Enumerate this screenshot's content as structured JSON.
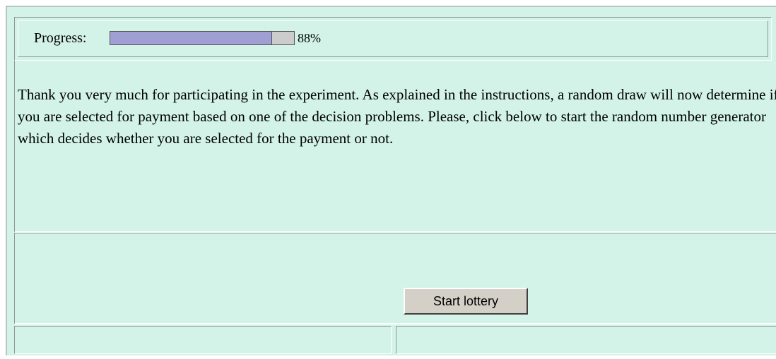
{
  "progress": {
    "label": "Progress:",
    "value": 0.88,
    "percent_text": "88%",
    "fill_color": "#9f9fd3",
    "track_color": "#cccccc"
  },
  "message": {
    "text": "Thank you very much for participating in the experiment. As explained in the instructions, a random draw will now determine if you are selected for payment based on one of the decision problems. Please, click below to start the random number generator which decides whether you are selected for the payment or not."
  },
  "actions": {
    "start_label": "Start lottery"
  },
  "colors": {
    "background": "#d3f3e8"
  }
}
